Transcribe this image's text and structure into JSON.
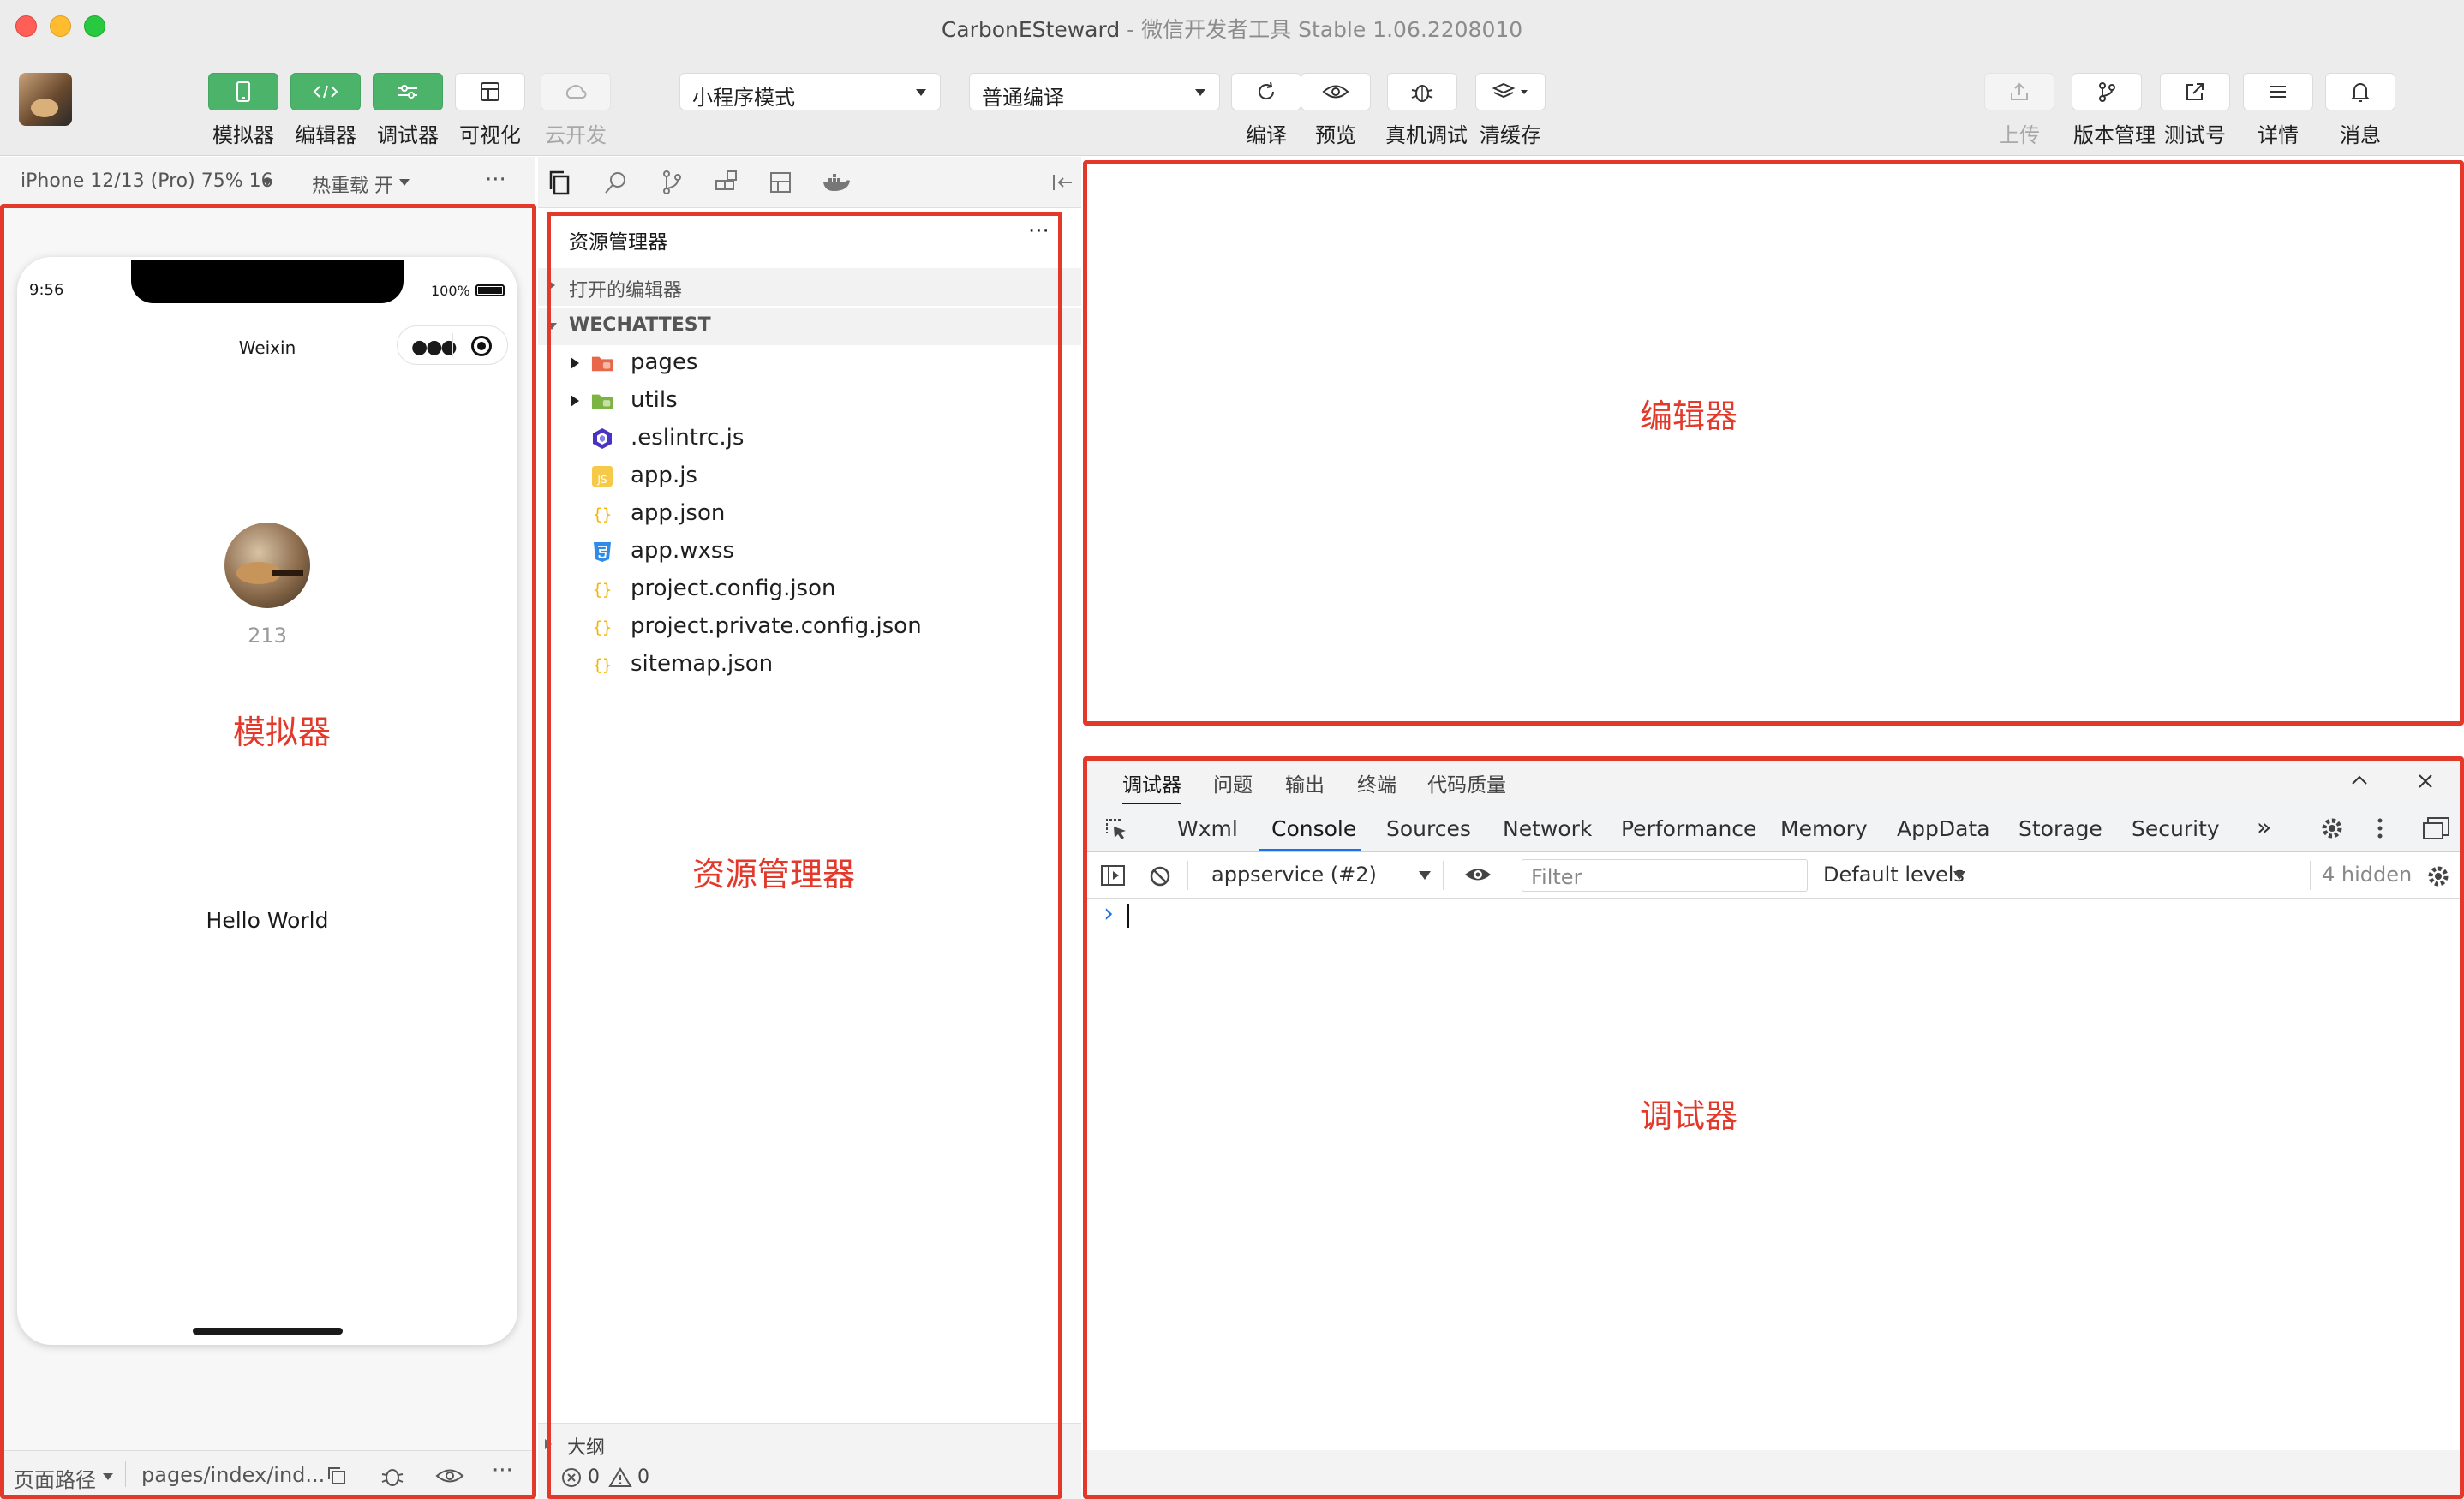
{
  "window": {
    "title": "CarbonESteward",
    "subtitle": "- 微信开发者工具 Stable 1.06.2208010"
  },
  "toolbar": {
    "simulator_label": "模拟器",
    "editor_label": "编辑器",
    "debugger_label": "调试器",
    "visual_label": "可视化",
    "cloud_label": "云开发",
    "mode_select": "小程序模式",
    "compile_select": "普通编译",
    "compile_label": "编译",
    "preview_label": "预览",
    "remote_debug_label": "真机调试",
    "clear_cache_label": "清缓存",
    "upload_label": "上传",
    "version_label": "版本管理",
    "test_account_label": "测试号",
    "details_label": "详情",
    "messages_label": "消息"
  },
  "simulator": {
    "device": "iPhone 12/13 (Pro) 75% 16",
    "hot_reload": "热重载 开",
    "more": "···",
    "time": "9:56",
    "battery": "100%",
    "nav_title": "Weixin",
    "count": "213",
    "hello": "Hello World",
    "path_label": "页面路径",
    "path_value": "pages/index/ind..."
  },
  "explorer": {
    "title": "资源管理器",
    "open_editors": "打开的编辑器",
    "project": "WECHATTEST",
    "files": [
      {
        "name": "pages",
        "icon": "folder-red-icon",
        "folder": true
      },
      {
        "name": "utils",
        "icon": "folder-green-icon",
        "folder": true
      },
      {
        "name": ".eslintrc.js",
        "icon": "eslint-icon",
        "folder": false
      },
      {
        "name": "app.js",
        "icon": "js-icon",
        "folder": false
      },
      {
        "name": "app.json",
        "icon": "json-icon",
        "folder": false
      },
      {
        "name": "app.wxss",
        "icon": "css-icon",
        "folder": false
      },
      {
        "name": "project.config.json",
        "icon": "json-icon",
        "folder": false
      },
      {
        "name": "project.private.config.json",
        "icon": "json-icon",
        "folder": false
      },
      {
        "name": "sitemap.json",
        "icon": "json-icon",
        "folder": false
      }
    ],
    "outline": "大纲",
    "errors": "0",
    "warnings": "0",
    "more": "···"
  },
  "debugger": {
    "tabs": [
      "调试器",
      "问题",
      "输出",
      "终端",
      "代码质量"
    ],
    "devtools_tabs": [
      "Wxml",
      "Console",
      "Sources",
      "Network",
      "Performance",
      "Memory",
      "AppData",
      "Storage",
      "Security"
    ],
    "more_tabs": "»",
    "context": "appservice (#2)",
    "filter_placeholder": "Filter",
    "levels": "Default levels",
    "hidden": "4 hidden",
    "prompt": "›"
  },
  "annotations": {
    "simulator": "模拟器",
    "explorer": "资源管理器",
    "editor": "编辑器",
    "debugger": "调试器"
  },
  "colors": {
    "accent_green": "#4bb36a",
    "annotation_red": "#e3392b",
    "devtools_blue": "#1a73e8"
  }
}
